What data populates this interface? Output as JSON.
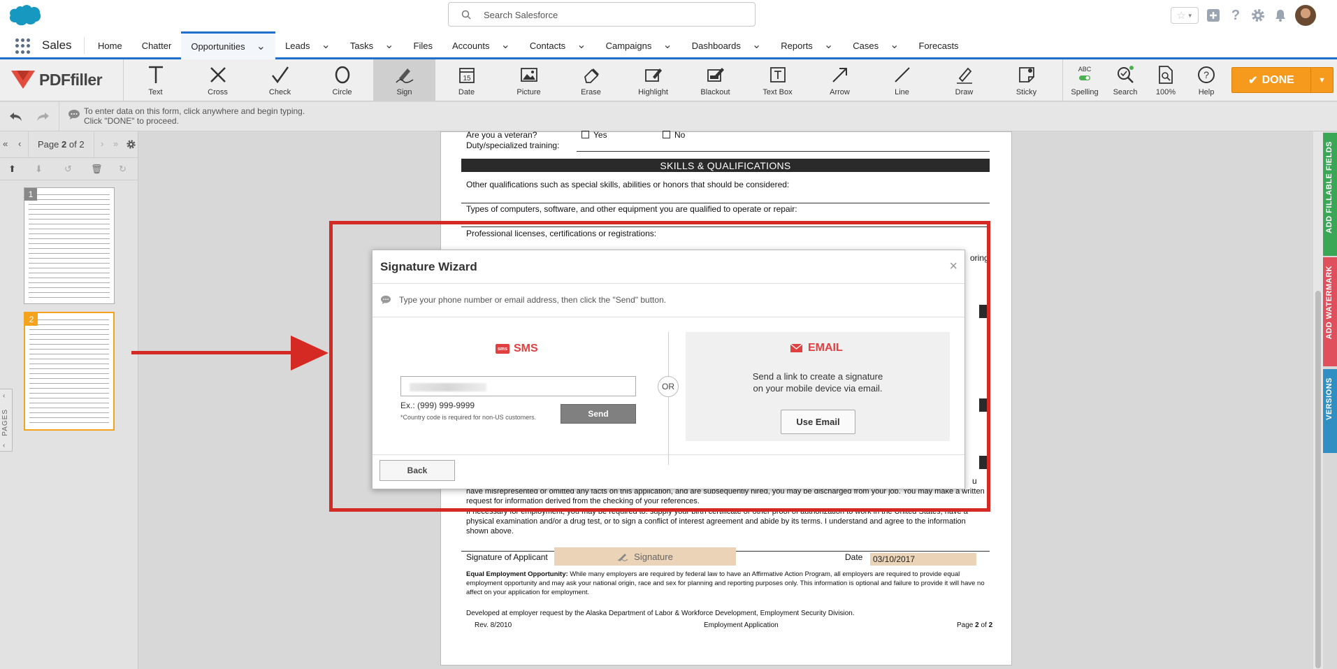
{
  "header": {
    "search_placeholder": "Search Salesforce"
  },
  "nav": {
    "app_name": "Sales",
    "items": [
      {
        "label": "Home",
        "chevron": false
      },
      {
        "label": "Chatter",
        "chevron": false
      },
      {
        "label": "Opportunities",
        "chevron": true,
        "active": true
      },
      {
        "label": "Leads",
        "chevron": true
      },
      {
        "label": "Tasks",
        "chevron": true
      },
      {
        "label": "Files",
        "chevron": false
      },
      {
        "label": "Accounts",
        "chevron": true
      },
      {
        "label": "Contacts",
        "chevron": true
      },
      {
        "label": "Campaigns",
        "chevron": true
      },
      {
        "label": "Dashboards",
        "chevron": true
      },
      {
        "label": "Reports",
        "chevron": true
      },
      {
        "label": "Cases",
        "chevron": true
      },
      {
        "label": "Forecasts",
        "chevron": false
      }
    ]
  },
  "pdffiller": {
    "logo_text": "PDFfiller",
    "tools": [
      {
        "label": "Text",
        "icon": "text-icon"
      },
      {
        "label": "Cross",
        "icon": "cross-icon"
      },
      {
        "label": "Check",
        "icon": "check-icon"
      },
      {
        "label": "Circle",
        "icon": "circle-icon"
      },
      {
        "label": "Sign",
        "icon": "sign-icon",
        "active": true
      },
      {
        "label": "Date",
        "icon": "date-icon"
      },
      {
        "label": "Picture",
        "icon": "picture-icon"
      },
      {
        "label": "Erase",
        "icon": "erase-icon"
      },
      {
        "label": "Highlight",
        "icon": "highlight-icon"
      },
      {
        "label": "Blackout",
        "icon": "blackout-icon"
      },
      {
        "label": "Text Box",
        "icon": "textbox-icon"
      },
      {
        "label": "Arrow",
        "icon": "arrow-icon"
      },
      {
        "label": "Line",
        "icon": "line-icon"
      },
      {
        "label": "Draw",
        "icon": "draw-icon"
      },
      {
        "label": "Sticky",
        "icon": "sticky-icon"
      }
    ],
    "right_tools": [
      {
        "label": "Spelling",
        "icon": "spelling-icon",
        "badge": "ABC"
      },
      {
        "label": "Search",
        "icon": "search-icon"
      },
      {
        "label": "100%",
        "icon": "zoom-icon"
      },
      {
        "label": "Help",
        "icon": "help-icon"
      }
    ],
    "done_label": "DONE",
    "date_icon_text": "15",
    "hint_line1": "To enter data on this form, click anywhere and begin typing.",
    "hint_line2": "Click \"DONE\" to proceed."
  },
  "pages": {
    "page_label": "Page",
    "current": "2",
    "of_label": "of",
    "total": "2",
    "thumb_numbers": [
      "1",
      "2"
    ],
    "tab_label": "PAGES"
  },
  "document": {
    "veteran_q": "Are you a veteran?",
    "yes": "Yes",
    "no": "No",
    "duty": "Duty/specialized training:",
    "skills_header": "SKILLS & QUALIFICATIONS",
    "q1": "Other qualifications such as special skills, abilities or honors that should be considered:",
    "q2": "Types of computers, software, and other equipment you are qualified to operate or repair:",
    "q3": "Professional licenses, certifications or registrations:",
    "partial_right": "oring",
    "partial_u": "u",
    "para1": "have misrepresented or omitted any facts on this application, and are subsequently hired, you may be discharged from your job. You may make a written request for information derived from the checking of your references.",
    "para2": "If necessary for employment, you may be required to: supply your birth certificate or other proof of authorization to work in the United States, have a physical examination and/or a drug test, or to sign a conflict of interest agreement and abide by its terms. I understand and agree to the information shown above.",
    "sig_label": "Signature of Applicant",
    "sig_field": "Signature",
    "date_label": "Date",
    "date_value": "03/10/2017",
    "eeo_title": "Equal Employment Opportunity:",
    "eeo_text": "While many employers are required by federal law to have an Affirmative Action Program, all employers are required to provide equal employment opportunity and may ask your national origin, race and sex for planning and reporting purposes only. This information is optional and failure to provide it will have no affect on your application for employment.",
    "developed": "Developed at employer request by the Alaska Department of Labor & Workforce Development, Employment Security Division.",
    "rev": "Rev. 8/2010",
    "footer_center": "Employment Application",
    "footer_page": "Page",
    "footer_page_num": "2",
    "footer_of": "of",
    "footer_total": "2"
  },
  "right_tabs": [
    {
      "label": "ADD FILLABLE FIELDS",
      "color": "#3aa757"
    },
    {
      "label": "ADD WATERMARK",
      "color": "#e0505c"
    },
    {
      "label": "VERSIONS",
      "color": "#2f8fc2"
    }
  ],
  "modal": {
    "title": "Signature Wizard",
    "hint": "Type your phone number or email address, then click the \"Send\" button.",
    "sms_title": "SMS",
    "sms_icon_text": "sms",
    "example": "Ex.: (999) 999-9999",
    "note": "*Country code is required for non-US customers.",
    "send_label": "Send",
    "or_label": "OR",
    "email_title": "EMAIL",
    "email_desc_1": "Send a link to create a signature",
    "email_desc_2": "on your mobile device via email.",
    "use_email_label": "Use Email",
    "back_label": "Back"
  },
  "colors": {
    "salesforce_blue": "#1f6fcf",
    "done_orange": "#f59a1c",
    "annotation_red": "#d42a23",
    "accent_red": "#e04040"
  }
}
